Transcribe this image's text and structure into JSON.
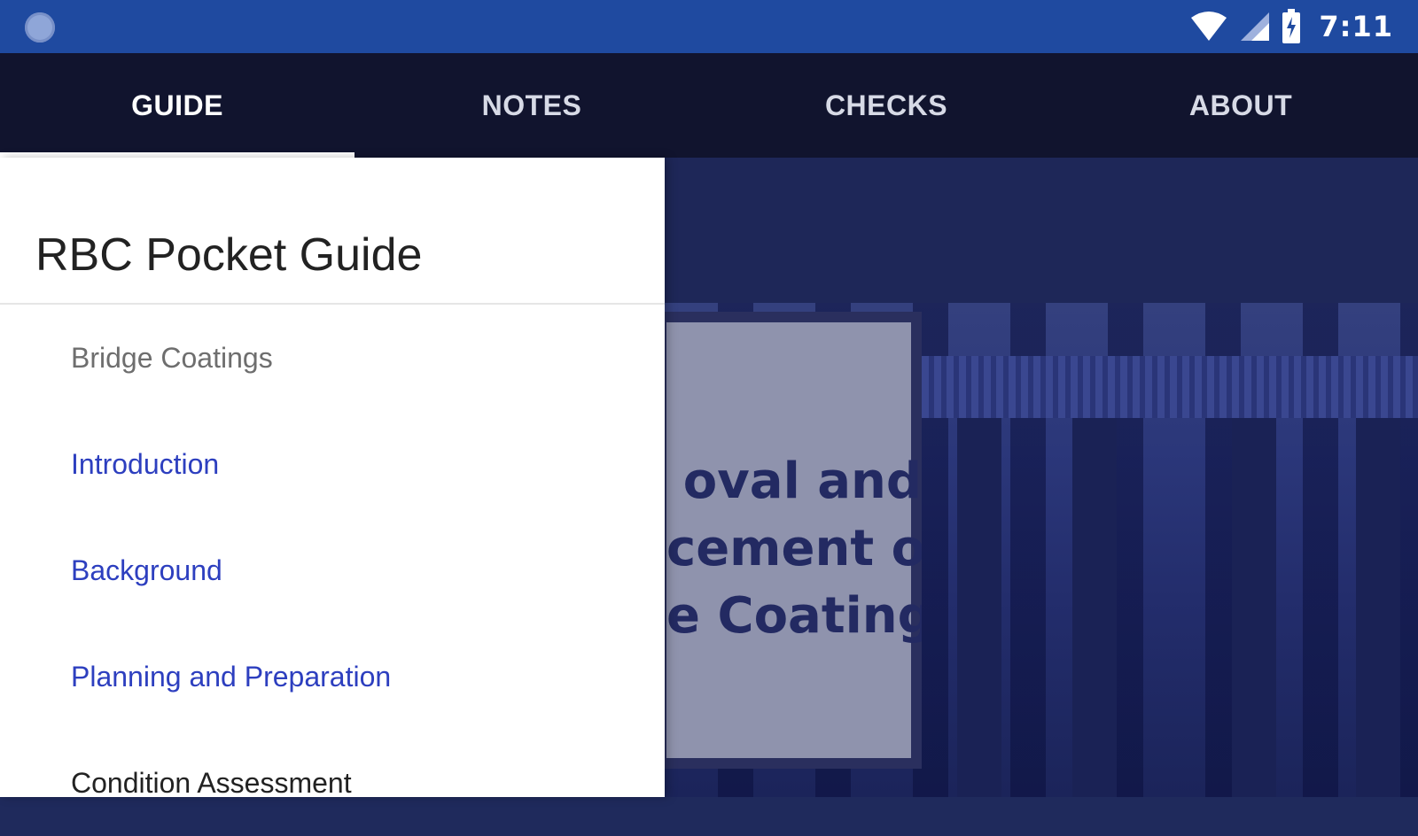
{
  "status_bar": {
    "time": "7:11",
    "icons": [
      "notification-dot-icon",
      "wifi-icon",
      "signal-icon",
      "battery-charging-icon"
    ]
  },
  "tabs": [
    {
      "label": "GUIDE",
      "active": true
    },
    {
      "label": "NOTES",
      "active": false
    },
    {
      "label": "CHECKS",
      "active": false
    },
    {
      "label": "ABOUT",
      "active": false
    }
  ],
  "drawer": {
    "title": "RBC Pocket Guide",
    "items": [
      {
        "label": "Bridge Coatings",
        "kind": "section"
      },
      {
        "label": "Introduction",
        "kind": "link"
      },
      {
        "label": "Background",
        "kind": "link"
      },
      {
        "label": "Planning and Preparation",
        "kind": "link"
      },
      {
        "label": "Condition Assessment",
        "kind": "plain"
      }
    ]
  },
  "hero": {
    "title_lines": [
      "oval and",
      "cement of",
      "e Coatings"
    ]
  },
  "colors": {
    "status_bar": "#1f4aa0",
    "tab_bar": "#11142e",
    "main_bg": "#1e2758",
    "link": "#2d3fbf"
  }
}
